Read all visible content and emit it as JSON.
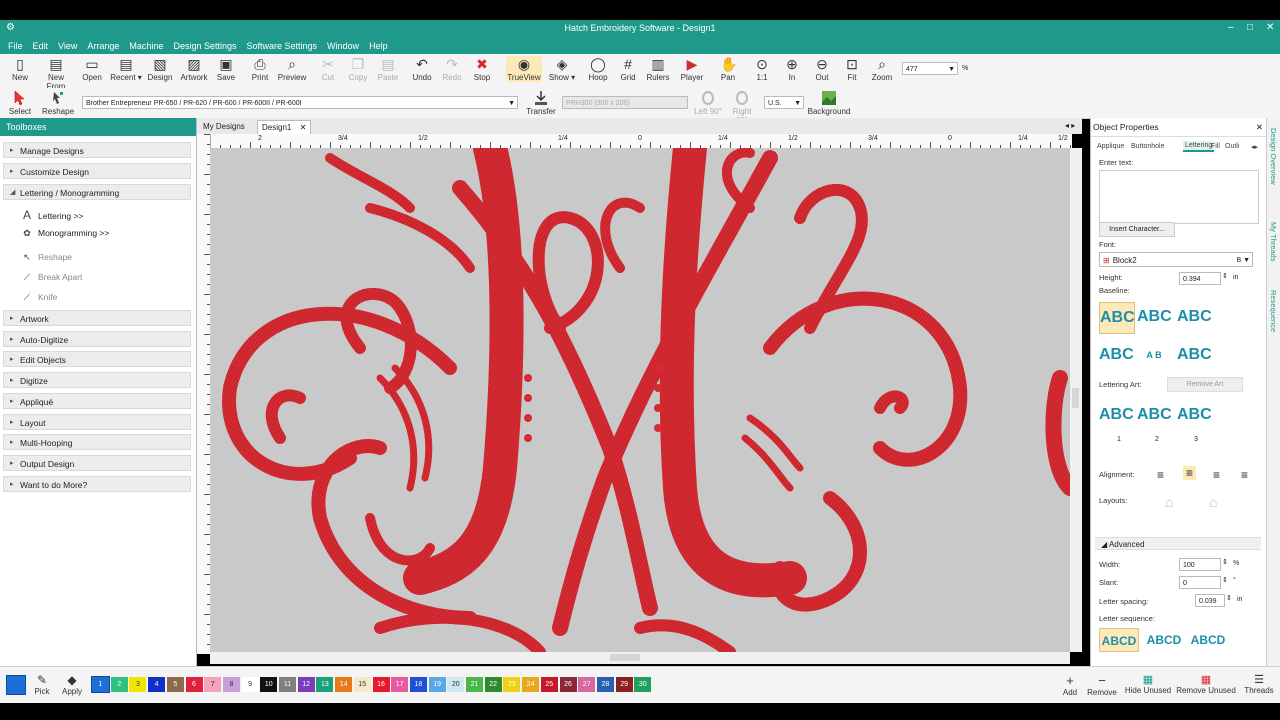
{
  "window": {
    "title": "Hatch Embroidery Software - Design1",
    "controls": [
      "–",
      "□",
      "✕"
    ]
  },
  "menu": [
    "File",
    "Edit",
    "View",
    "Arrange",
    "Machine",
    "Design Settings",
    "Software Settings",
    "Window",
    "Help"
  ],
  "toolbar": [
    {
      "label": "New",
      "icon": "new-file-icon",
      "enabled": true
    },
    {
      "label": "New From",
      "icon": "new-from-icon",
      "enabled": true
    },
    {
      "label": "Open",
      "icon": "folder-icon",
      "enabled": true
    },
    {
      "label": "Recent ▾",
      "icon": "recent-icon",
      "enabled": true
    },
    {
      "label": "Design",
      "icon": "design-icon",
      "enabled": true
    },
    {
      "label": "Artwork",
      "icon": "artwork-icon",
      "enabled": true
    },
    {
      "label": "Save",
      "icon": "save-icon",
      "enabled": true
    },
    {
      "label": "Print",
      "icon": "print-icon",
      "enabled": true
    },
    {
      "label": "Preview",
      "icon": "preview-icon",
      "enabled": true
    },
    {
      "label": "Cut",
      "icon": "cut-icon",
      "enabled": false
    },
    {
      "label": "Copy",
      "icon": "copy-icon",
      "enabled": false
    },
    {
      "label": "Paste",
      "icon": "paste-icon",
      "enabled": false
    },
    {
      "label": "Undo",
      "icon": "undo-icon",
      "enabled": true
    },
    {
      "label": "Redo",
      "icon": "redo-icon",
      "enabled": false
    },
    {
      "label": "Stop",
      "icon": "stop-icon",
      "enabled": true
    },
    {
      "label": "TrueView",
      "icon": "trueview-icon",
      "enabled": true
    },
    {
      "label": "Show ▾",
      "icon": "show-icon",
      "enabled": true
    },
    {
      "label": "Hoop",
      "icon": "hoop-icon",
      "enabled": true
    },
    {
      "label": "Grid",
      "icon": "grid-icon",
      "enabled": true
    },
    {
      "label": "Rulers",
      "icon": "rulers-icon",
      "enabled": true
    },
    {
      "label": "Player",
      "icon": "player-icon",
      "enabled": true
    },
    {
      "label": "Pan",
      "icon": "pan-icon",
      "enabled": true
    },
    {
      "label": "1:1",
      "icon": "zoom-actual-icon",
      "enabled": true
    },
    {
      "label": "In",
      "icon": "zoom-in-icon",
      "enabled": true
    },
    {
      "label": "Out",
      "icon": "zoom-out-icon",
      "enabled": true
    },
    {
      "label": "Fit",
      "icon": "zoom-fit-icon",
      "enabled": true
    },
    {
      "label": "Zoom",
      "icon": "zoom-icon",
      "enabled": true
    }
  ],
  "zoom": {
    "value": "477",
    "unit": "%"
  },
  "toolbar2": {
    "select": "Select",
    "reshape": "Reshape",
    "machine": "Brother Entrepreneur PR-650 / PR-620 / PR-600 / PR-600II / PR-600I",
    "transfer": "Transfer",
    "hoop": "PRH300 (300 x 200)",
    "left90": "Left 90°",
    "right90": "Right 90°",
    "units": "U.S.",
    "background": "Background"
  },
  "toolboxes": {
    "title": "Toolboxes",
    "groups_top": [
      {
        "label": "Manage Designs",
        "open": false
      },
      {
        "label": "Customize Design",
        "open": false
      },
      {
        "label": "Lettering / Monogramming",
        "open": true
      }
    ],
    "sub_items": [
      {
        "label": "Lettering >>",
        "icon": "lettering-icon",
        "enabled": true
      },
      {
        "label": "Monogramming >>",
        "icon": "monogram-icon",
        "enabled": true
      },
      {
        "label": "Reshape",
        "icon": "reshape-icon",
        "enabled": false
      },
      {
        "label": "Break Apart",
        "icon": "break-apart-icon",
        "enabled": false
      },
      {
        "label": "Knife",
        "icon": "knife-icon",
        "enabled": false
      }
    ],
    "groups_bottom": [
      "Artwork",
      "Auto-Digitize",
      "Edit Objects",
      "Digitize",
      "Appliqué",
      "Layout",
      "Multi-Hooping",
      "Output Design",
      "Want to do More?"
    ]
  },
  "doc_tabs": [
    "My Designs",
    "Design1"
  ],
  "ruler_labels": [
    "2",
    "3/4",
    "1/2",
    "1/4",
    "0",
    "1/4",
    "1/2",
    "3/4",
    "0",
    "1/4",
    "1/2"
  ],
  "object_properties": {
    "title": "Object Properties",
    "tabs": [
      "Applique",
      "Buttonhole",
      "Lettering",
      "Fill",
      "Outli"
    ],
    "active_tab": "Lettering",
    "enter_text_label": "Enter text:",
    "enter_text_value": "",
    "insert_char": "Insert Character...",
    "font_label": "Font:",
    "font_value": "Block2",
    "height_label": "Height:",
    "height_value": "0.394",
    "height_unit": "in",
    "baseline_label": "Baseline:",
    "abc": "ABC",
    "lettering_art_label": "Lettering Art:",
    "remove_art": "Remove Art",
    "art_numbers": [
      "1",
      "2",
      "3"
    ],
    "alignment_label": "Alignment:",
    "layouts_label": "Layouts:",
    "advanced_label": "Advanced",
    "width_label": "Width:",
    "width_value": "100",
    "width_unit": "%",
    "slant_label": "Slant:",
    "slant_value": "0",
    "slant_unit": "°",
    "spacing_label": "Letter spacing:",
    "spacing_value": "0.039",
    "spacing_unit": "in",
    "sequence_label": "Letter sequence:",
    "abcd": "ABCD"
  },
  "side_tabs": [
    "Design Overview",
    "My Threads",
    "Resequence"
  ],
  "palette": {
    "swatches": [
      {
        "n": "1",
        "color": "#1b6fd6"
      },
      {
        "n": "2",
        "color": "#2ec27e"
      },
      {
        "n": "3",
        "color": "#f2e600"
      },
      {
        "n": "4",
        "color": "#1030c8"
      },
      {
        "n": "5",
        "color": "#8c6a4a"
      },
      {
        "n": "6",
        "color": "#e0203c"
      },
      {
        "n": "7",
        "color": "#f5a3b8"
      },
      {
        "n": "8",
        "color": "#c8a0d8"
      },
      {
        "n": "9",
        "color": "#ffffff"
      },
      {
        "n": "10",
        "color": "#111111"
      },
      {
        "n": "11",
        "color": "#808080"
      },
      {
        "n": "12",
        "color": "#7a3cb8"
      },
      {
        "n": "13",
        "color": "#1aa37a"
      },
      {
        "n": "14",
        "color": "#e87a1c"
      },
      {
        "n": "15",
        "color": "#f6e8c8"
      },
      {
        "n": "16",
        "color": "#e8182c"
      },
      {
        "n": "17",
        "color": "#e85aa0"
      },
      {
        "n": "18",
        "color": "#2050d8"
      },
      {
        "n": "19",
        "color": "#58a8e8"
      },
      {
        "n": "20",
        "color": "#d0e8f0"
      },
      {
        "n": "21",
        "color": "#48b848"
      },
      {
        "n": "22",
        "color": "#2e8a2e"
      },
      {
        "n": "23",
        "color": "#f0d010"
      },
      {
        "n": "24",
        "color": "#e8a818"
      },
      {
        "n": "25",
        "color": "#c81828"
      },
      {
        "n": "26",
        "color": "#8a2838"
      },
      {
        "n": "27",
        "color": "#d868a0"
      },
      {
        "n": "28",
        "color": "#2860b0"
      },
      {
        "n": "29",
        "color": "#8a2020"
      },
      {
        "n": "30",
        "color": "#20a060"
      }
    ],
    "pick": "Pick",
    "apply": "Apply",
    "add": "Add",
    "remove": "Remove",
    "hide_unused": "Hide Unused",
    "remove_unused": "Remove Unused",
    "threads": "Threads"
  },
  "colors": {
    "accent": "#1f9a8a",
    "thread": "#d8262e"
  }
}
